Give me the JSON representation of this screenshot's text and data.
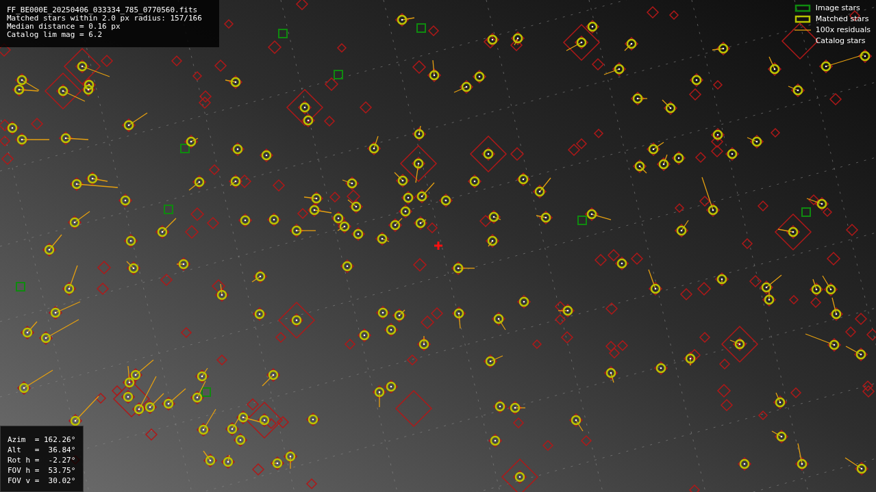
{
  "info_panel": {
    "lines": [
      "FF_BE000E_20250406_033334_785_0770560.fits",
      "Matched stars within 2.0 px radius: 157/166",
      "Median distance = 0.16 px",
      "Catalog lim mag = 6.2"
    ]
  },
  "legend": {
    "items": [
      {
        "label": "Image stars",
        "kind": "image"
      },
      {
        "label": "Matched stars",
        "kind": "matched"
      },
      {
        "label": "100x residuals",
        "kind": "residual"
      },
      {
        "label": "Catalog stars",
        "kind": "catalog"
      }
    ]
  },
  "pointing_panel": {
    "lines": [
      "Azim  = 162.26°",
      "Alt   =  36.84°",
      "Rot h =  -2.27°",
      "FOV h =  53.75°",
      "FOV v =  30.02°"
    ]
  }
}
